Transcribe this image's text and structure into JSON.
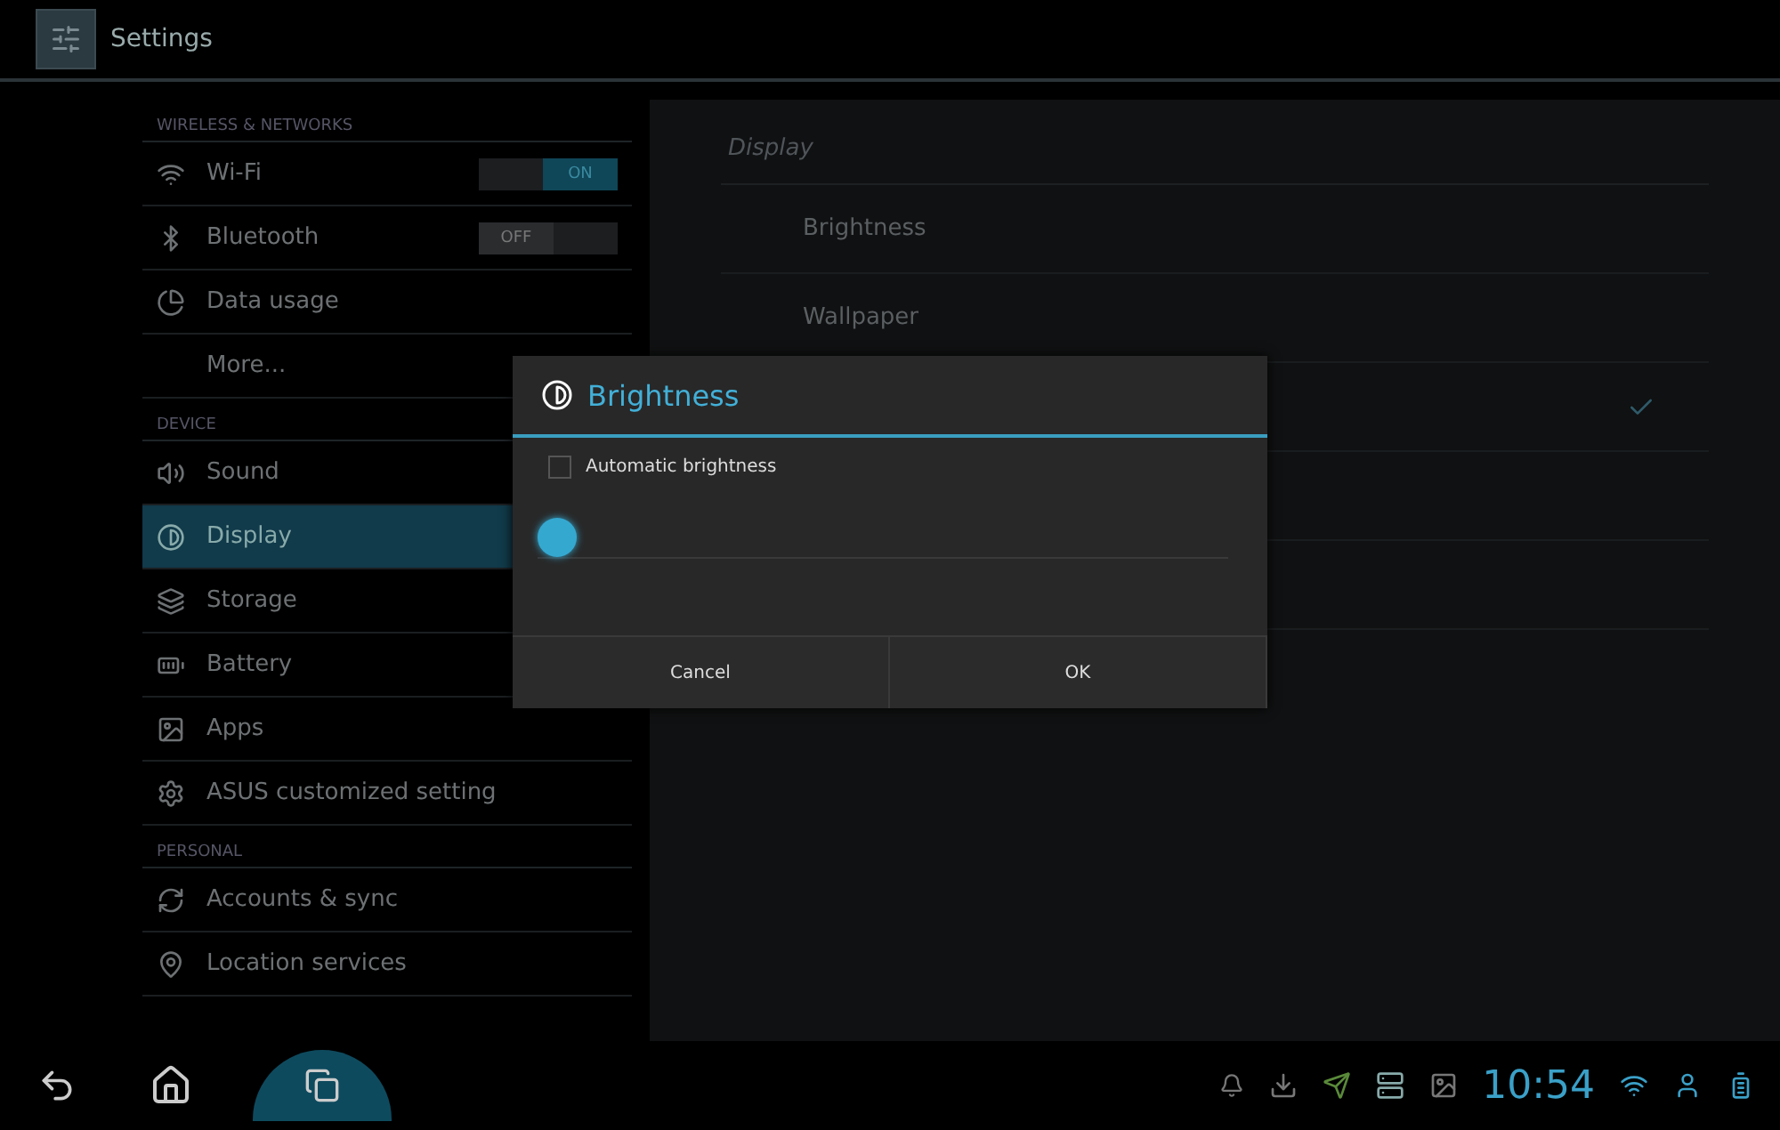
{
  "action_bar": {
    "title": "Settings"
  },
  "sidebar": {
    "items": [
      {
        "kind": "header",
        "label": "WIRELESS & NETWORKS"
      },
      {
        "kind": "toggle",
        "label": "Wi-Fi",
        "on": true,
        "toggle_text": "ON",
        "selected": false
      },
      {
        "kind": "toggle",
        "label": "Bluetooth",
        "on": false,
        "toggle_text": "OFF",
        "selected": false
      },
      {
        "kind": "item",
        "label": "Data usage",
        "selected": false
      },
      {
        "kind": "item",
        "label": "More...",
        "selected": false
      },
      {
        "kind": "header",
        "label": "DEVICE"
      },
      {
        "kind": "item",
        "label": "Sound",
        "selected": false
      },
      {
        "kind": "item",
        "label": "Display",
        "selected": true
      },
      {
        "kind": "item",
        "label": "Storage",
        "selected": false
      },
      {
        "kind": "item",
        "label": "Battery",
        "selected": false
      },
      {
        "kind": "item",
        "label": "Apps",
        "selected": false
      },
      {
        "kind": "item",
        "label": "ASUS customized setting",
        "selected": false
      },
      {
        "kind": "header",
        "label": "PERSONAL"
      },
      {
        "kind": "item",
        "label": "Accounts & sync",
        "selected": false
      },
      {
        "kind": "item",
        "label": "Location services",
        "selected": false
      }
    ]
  },
  "display_pane": {
    "title": "Display",
    "rows": [
      {
        "kind": "item",
        "label": "Brightness"
      },
      {
        "kind": "item",
        "label": "Wallpaper"
      },
      {
        "kind": "checkbox",
        "checked": true
      },
      {
        "kind": "empty"
      },
      {
        "kind": "empty"
      }
    ]
  },
  "dialog": {
    "title": "Brightness",
    "auto_checkbox": {
      "label": "Automatic brightness",
      "checked": false
    },
    "slider": {
      "level": 0.0
    },
    "buttons": [
      "Cancel",
      "OK"
    ]
  },
  "status_bar": {
    "time": "10:54"
  }
}
